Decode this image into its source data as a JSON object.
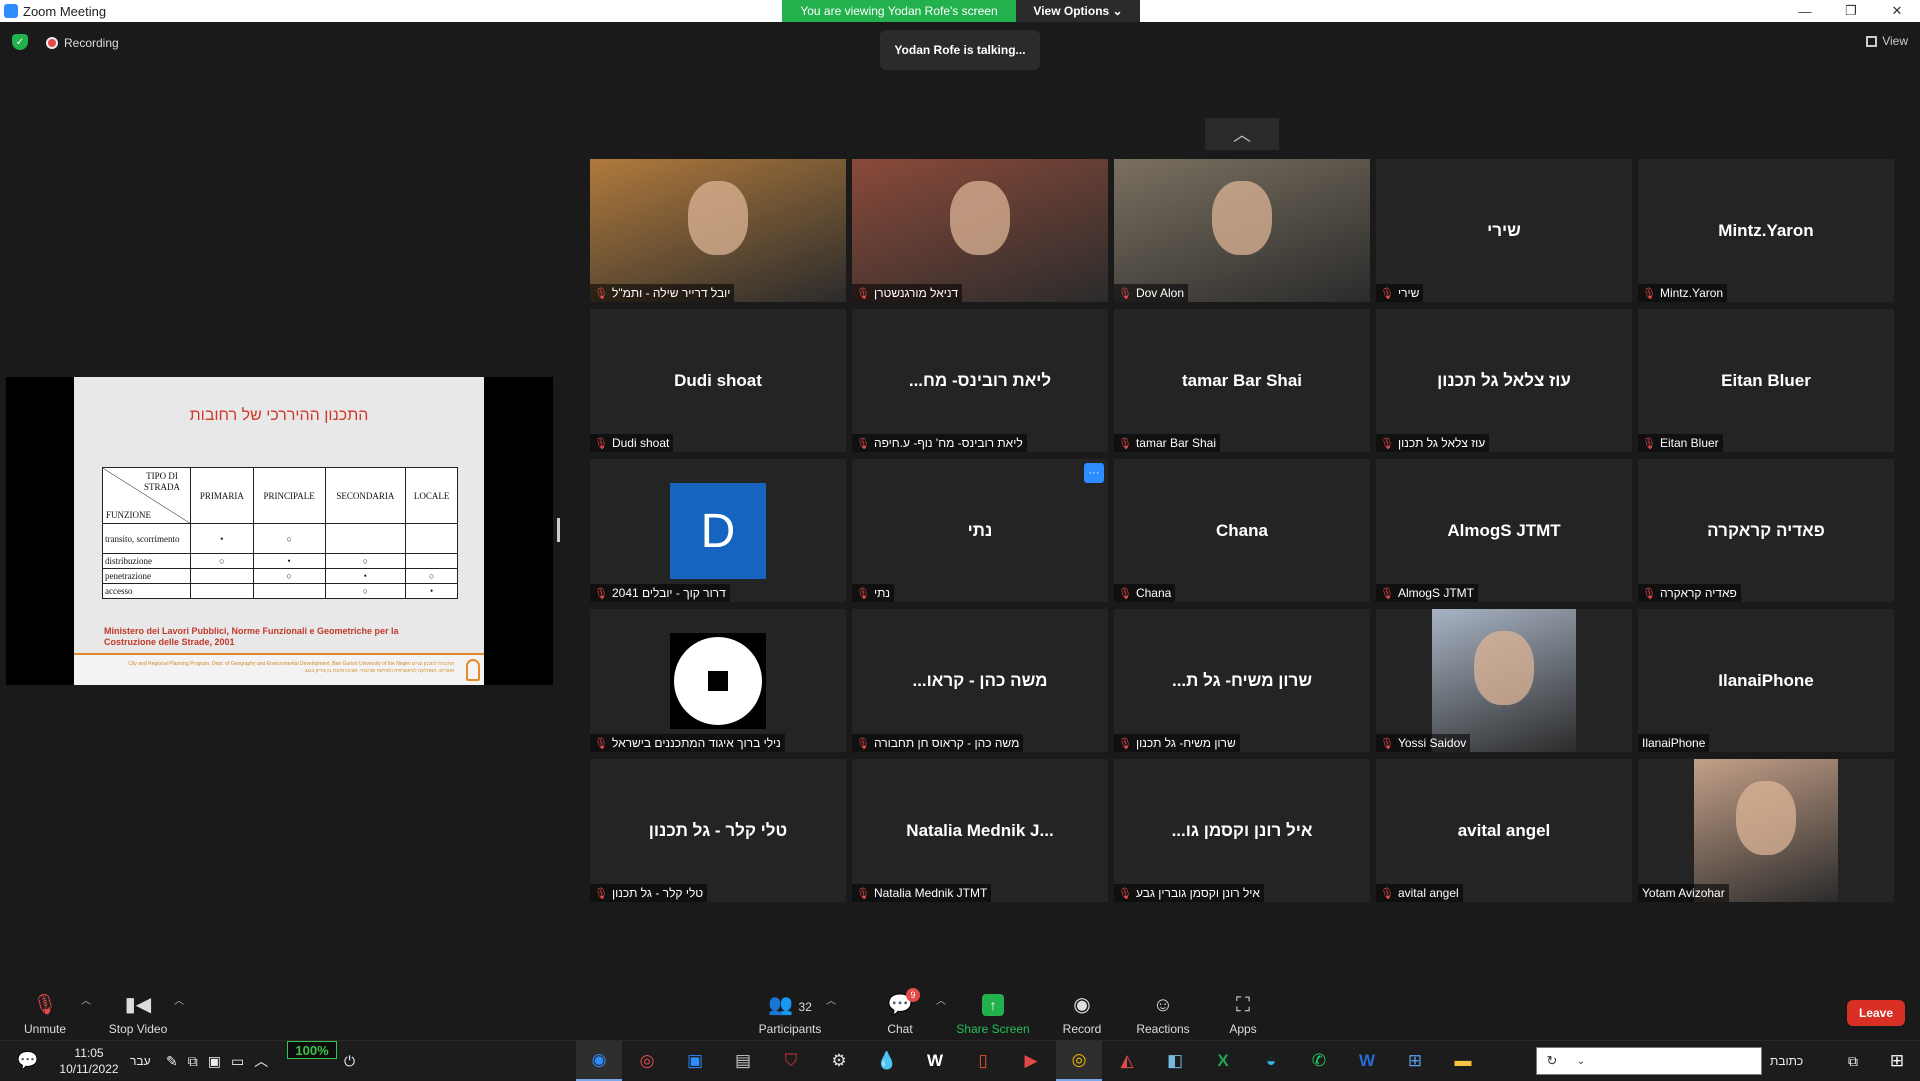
{
  "window": {
    "title": "Zoom Meeting",
    "min": "—",
    "max": "❐",
    "close": "✕"
  },
  "share_banner": {
    "viewing": "You are viewing Yodan Rofe's screen",
    "view_options": "View Options ⌄"
  },
  "talking": "Yodan Rofe is talking...",
  "recording": "Recording",
  "view_label": "View",
  "slide": {
    "title": "התכנון ההיררכי של רחובות",
    "header_corner_top": "TIPO DI STRADA",
    "header_corner_bottom": "FUNZIONE",
    "columns": [
      "PRIMARIA",
      "PRINCIPALE",
      "SECONDARIA",
      "LOCALE"
    ],
    "rows": [
      {
        "label": "transito, scorrimento",
        "cells": [
          "•",
          "○",
          "",
          ""
        ]
      },
      {
        "label": "distribuzione",
        "cells": [
          "○",
          "•",
          "○",
          ""
        ]
      },
      {
        "label": "penetrazione",
        "cells": [
          "",
          "○",
          "•",
          "○"
        ]
      },
      {
        "label": "accesso",
        "cells": [
          "",
          "",
          "○",
          "•"
        ]
      }
    ],
    "caption": "Ministero dei Lavori Pubblici, Norme Funzionali e Geometriche per la Costruzione delle Strade, 2001",
    "footer": "City and Regional Planning Program, Dept. of Geography and Environmental Development, Ben Gurion University of the Negev התכנית לתכנון ערים ואזורים, המחלקה לגיאוגרפיה ולפיתוח סביבתי, אוניברסיטת בן גוריון בנגב"
  },
  "tiles": [
    {
      "big": "",
      "name": "יובל דרייר שילה - ותמ\"ל",
      "photo": "#b07a3c"
    },
    {
      "big": "",
      "name": "דניאל מורגנשטרן",
      "photo": "#8a4a3a"
    },
    {
      "big": "",
      "name": "Dov Alon",
      "photo": "#7a7060"
    },
    {
      "big": "שירי",
      "name": "שירי"
    },
    {
      "big": "Mintz.Yaron",
      "name": "Mintz.Yaron"
    },
    {
      "big": "Dudi shoat",
      "name": "Dudi shoat"
    },
    {
      "big": "...ליאת רובינס- מח",
      "name": "ליאת רובינס- מח' נוף- ע.חיפה"
    },
    {
      "big": "tamar Bar Shai",
      "name": "tamar Bar Shai"
    },
    {
      "big": "עוז צלאל גל תכנון",
      "name": "עוז צלאל גל תכנון"
    },
    {
      "big": "Eitan Bluer",
      "name": "Eitan Bluer"
    },
    {
      "big": "",
      "name": "דרור קוך - יובלים 2041",
      "avatar_letter": "D"
    },
    {
      "big": "נתי",
      "name": "נתי",
      "more": "···"
    },
    {
      "big": "Chana",
      "name": "Chana"
    },
    {
      "big": "AlmogS JTMT",
      "name": "AlmogS JTMT"
    },
    {
      "big": "פאדיה קראקרה",
      "name": "פאדיה קראקרה"
    },
    {
      "big": "",
      "name": "נילי ברוך איגוד המתכננים בישראל",
      "avatar_logo": true
    },
    {
      "big": "...משה כהן - קראו",
      "name": "משה כהן - קראוס חן תחבורה"
    },
    {
      "big": "...שרון משיח- גל ת",
      "name": "שרון משיח- גל תכנון"
    },
    {
      "big": "",
      "name": "Yossi Saidov",
      "photo": "#a8b4c4"
    },
    {
      "big": "IlanaiPhone",
      "name": "IlanaiPhone",
      "no_mic": true
    },
    {
      "big": "טלי קלר - גל תכנון",
      "name": "טלי קלר - גל תכנון"
    },
    {
      "big": "Natalia  Mednik J...",
      "name": "Natalia Mednik JTMT"
    },
    {
      "big": "...איל רונן וקסמן גו",
      "name": "איל רונן וקסמן גוברין גבע"
    },
    {
      "big": "avital angel",
      "name": "avital angel"
    },
    {
      "big": "",
      "name": "Yotam Avizohar",
      "photo": "#c4a088",
      "no_mic": true
    }
  ],
  "toolbar": {
    "unmute": "Unmute",
    "stop_video": "Stop Video",
    "participants": "Participants",
    "participants_count": "32",
    "chat": "Chat",
    "chat_badge": "9",
    "share": "Share Screen",
    "record": "Record",
    "reactions": "Reactions",
    "apps": "Apps",
    "leave": "Leave"
  },
  "taskbar": {
    "time": "11:05",
    "date": "10/11/2022",
    "lang": "עבר",
    "battery": "100%",
    "search_label": "כתובת"
  }
}
